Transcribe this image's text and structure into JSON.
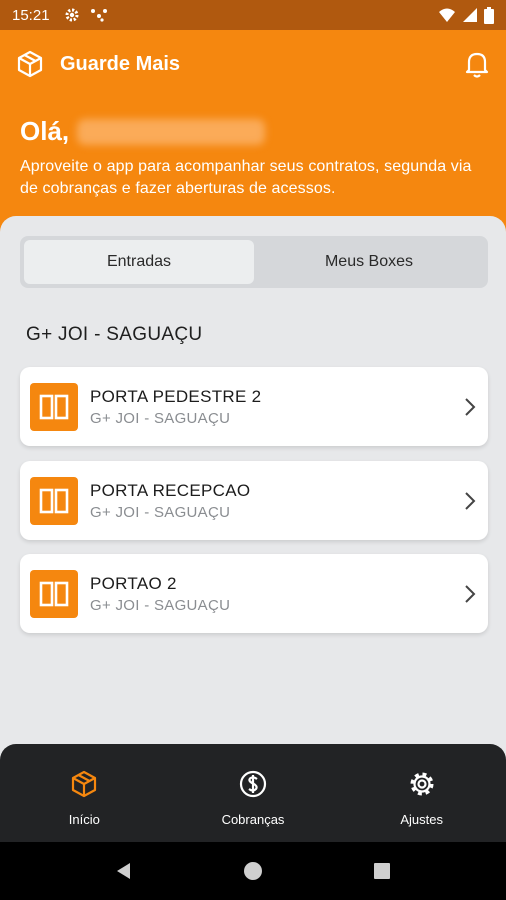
{
  "status_bar": {
    "time": "15:21"
  },
  "app": {
    "title": "Guarde Mais"
  },
  "greeting": {
    "hello": "Olá,",
    "subtitle": "Aproveite o app para acompanhar seus contratos, segunda via de cobranças e fazer aberturas de acessos."
  },
  "tabs": [
    {
      "label": "Entradas",
      "active": true
    },
    {
      "label": "Meus Boxes",
      "active": false
    }
  ],
  "section": {
    "title": "G+ JOI - SAGUAÇU"
  },
  "entries": [
    {
      "name": "PORTA PEDESTRE 2",
      "location": "G+ JOI - SAGUAÇU"
    },
    {
      "name": "PORTA RECEPCAO",
      "location": "G+ JOI - SAGUAÇU"
    },
    {
      "name": "PORTAO 2",
      "location": "G+ JOI - SAGUAÇU"
    }
  ],
  "bottom_nav": [
    {
      "label": "Início",
      "icon": "box-icon",
      "active": true
    },
    {
      "label": "Cobranças",
      "icon": "dollar-icon",
      "active": false
    },
    {
      "label": "Ajustes",
      "icon": "gear-icon",
      "active": false
    }
  ],
  "colors": {
    "accent": "#f5870f",
    "status_bar": "#b0590f",
    "nav_bg": "#222325"
  }
}
